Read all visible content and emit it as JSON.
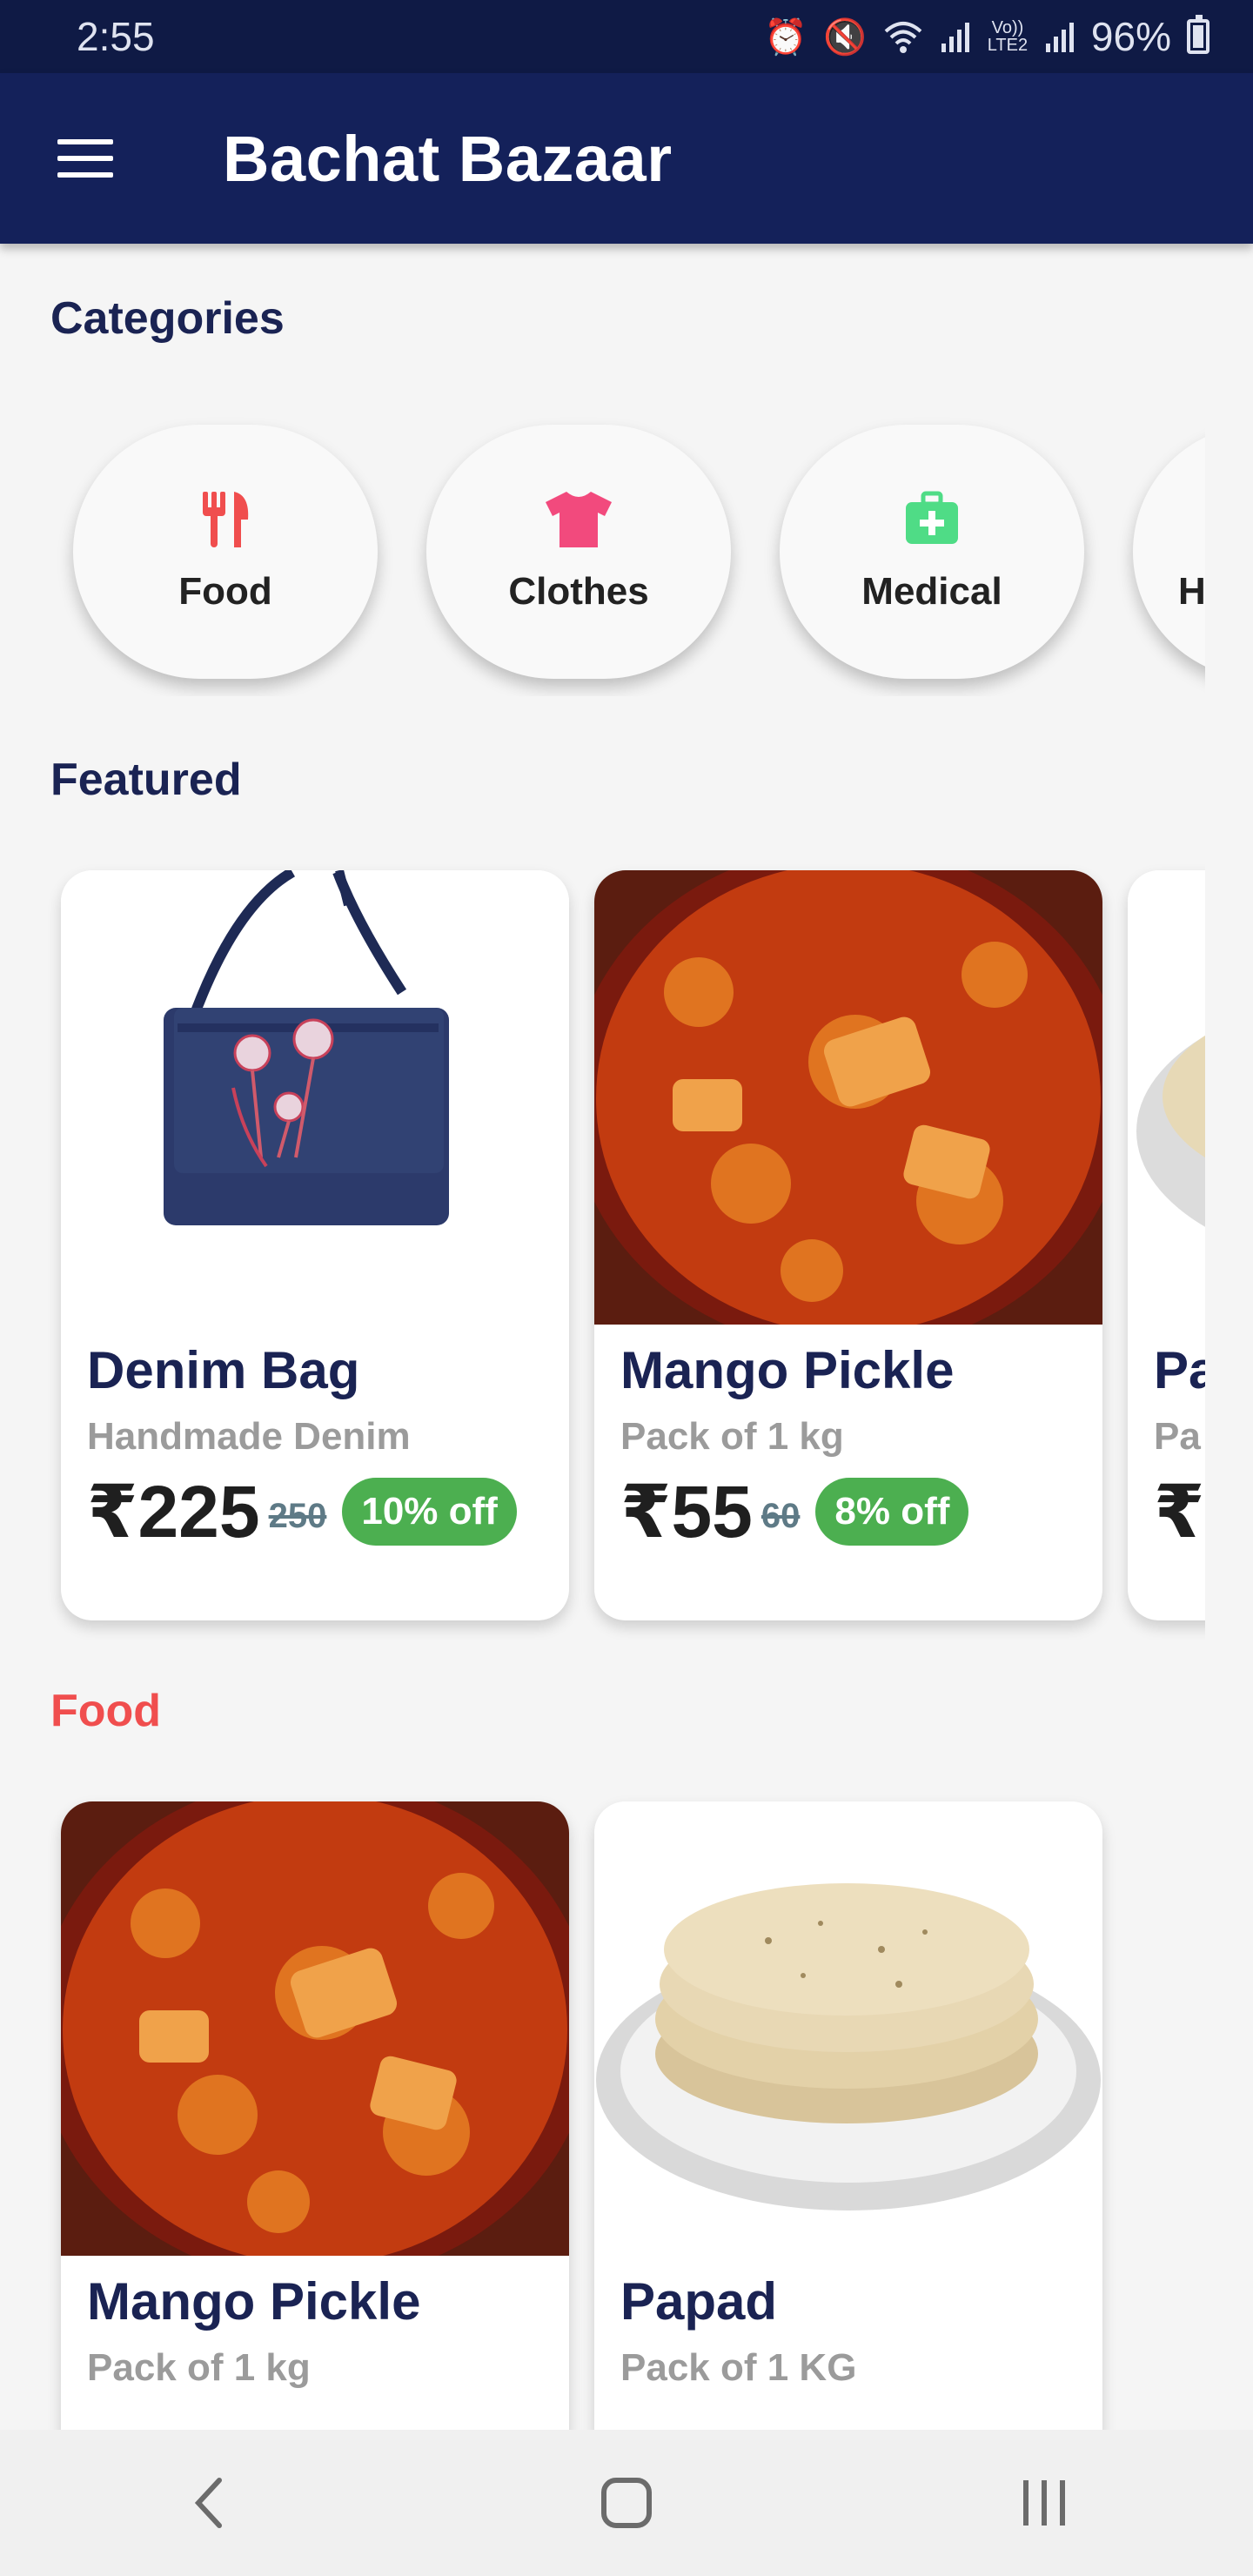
{
  "status_bar": {
    "time": "2:55",
    "battery": "96%",
    "network": "Vo)) LTE2"
  },
  "app_bar": {
    "title": "Bachat Bazaar"
  },
  "categories": {
    "title": "Categories",
    "items": [
      {
        "label": "Food",
        "icon": "fork-knife-icon",
        "color": "#f04e4e"
      },
      {
        "label": "Clothes",
        "icon": "tshirt-icon",
        "color": "#f24a7d"
      },
      {
        "label": "Medical",
        "icon": "medical-kit-icon",
        "color": "#4fdc86"
      },
      {
        "label": "H",
        "icon": "",
        "color": "#222222"
      }
    ]
  },
  "featured": {
    "title": "Featured",
    "items": [
      {
        "name": "Denim Bag",
        "subtitle": "Handmade Denim",
        "price": "₹225",
        "mrp": "250",
        "discount": "10% off"
      },
      {
        "name": "Mango Pickle",
        "subtitle": "Pack of 1 kg",
        "price": "₹55",
        "mrp": "60",
        "discount": "8% off"
      },
      {
        "name": "Pa",
        "subtitle": "Pa",
        "price": "₹"
      }
    ]
  },
  "food": {
    "title": "Food",
    "items": [
      {
        "name": "Mango Pickle",
        "subtitle": "Pack of 1 kg"
      },
      {
        "name": "Papad",
        "subtitle": "Pack of 1 KG"
      }
    ]
  },
  "colors": {
    "primary": "#14215a",
    "status_bar": "#0f1a45",
    "accent_food": "#f04e4e",
    "discount": "#4caf50"
  }
}
